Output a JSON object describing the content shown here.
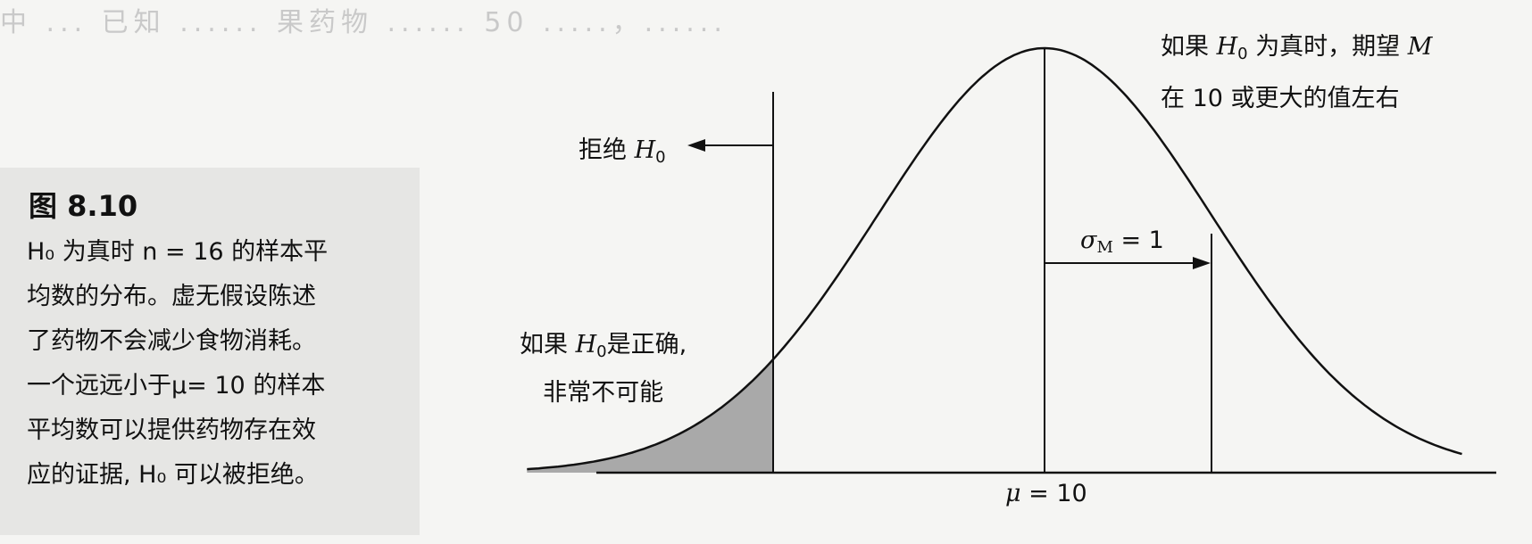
{
  "background_text": "中 ... 已知 ...... 果药物 ...... 50 .....，......",
  "figure": {
    "title": "图 8.10",
    "caption_lines": [
      "H₀ 为真时 n = 16 的样本平",
      "均数的分布。虚无假设陈述",
      "了药物不会减少食物消耗。",
      "一个远远小于μ= 10 的样本",
      "平均数可以提供药物存在效",
      "应的证据, H₀ 可以被拒绝。"
    ]
  },
  "labels": {
    "reject_prefix": "拒绝",
    "reject_var": "H",
    "reject_sub": "0",
    "top_right_line1_prefix": "如果",
    "top_right_line1_var": "H",
    "top_right_line1_sub": "0",
    "top_right_line1_mid": "为真时，期望",
    "top_right_line1_m": "M",
    "top_right_line2": "在 10 或更大的值左右",
    "sigma_symbol": "σ",
    "sigma_sub": "M",
    "sigma_value": "= 1",
    "unlikely_line1_prefix": "如果",
    "unlikely_line1_var": "H",
    "unlikely_line1_sub": "0",
    "unlikely_line1_suffix": "是正确,",
    "unlikely_line2": "非常不可能",
    "mu_symbol": "μ",
    "mu_value": "= 10"
  },
  "chart_data": {
    "type": "area",
    "distribution": "normal",
    "mean": 10,
    "sd": 1,
    "x_range": [
      6.9,
      12.5
    ],
    "critical_region": "left tail shaded",
    "colors": {
      "curve": "#111111",
      "shade": "#a9a9a9"
    }
  }
}
